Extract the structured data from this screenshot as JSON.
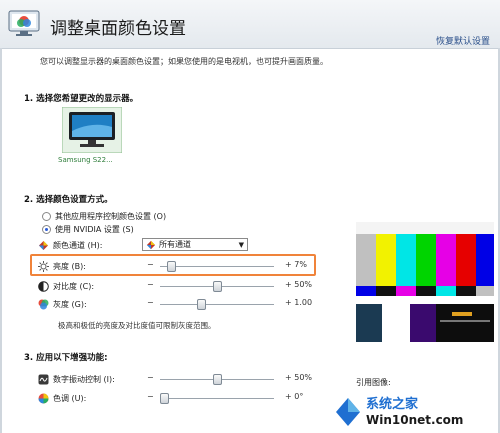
{
  "header": {
    "title": "调整桌面颜色设置",
    "restore_label": "恢复默认设置"
  },
  "description": "您可以调整显示器的桌面颜色设置；如果您使用的是电视机，也可提升画面质量。",
  "section1": {
    "heading": "1. 选择您希望更改的显示器。",
    "display_label": "Samsung S22..."
  },
  "section2": {
    "heading": "2. 选择颜色设置方式。",
    "radio_other": "其他应用程序控制颜色设置 (O)",
    "radio_nvidia": "使用 NVIDIA 设置 (S)",
    "channel_label": "颜色通道 (H):",
    "channel_value": "所有通道",
    "brightness": {
      "label": "亮度 (B):",
      "value": "+ 7%",
      "level": 0.07
    },
    "contrast": {
      "label": "对比度 (C):",
      "value": "+ 50%",
      "level": 0.5
    },
    "gamma": {
      "label": "灰度 (G):",
      "value": "+ 1.00",
      "level": 0.35
    },
    "note": "极高和极低的亮度及对比度值可限制灰度范围。"
  },
  "section3": {
    "heading": "3. 应用以下增强功能:",
    "vibrance": {
      "label": "数字振动控制 (I):",
      "value": "+ 50%",
      "level": 0.5
    },
    "hue": {
      "label": "色调 (U):",
      "value": "+ 0°",
      "level": 0.0
    },
    "ref_label": "引用图像:"
  },
  "minus": "−",
  "watermark": {
    "text": "Win10net.com",
    "brand": "系统之家"
  },
  "colors": {
    "highlight": "#f0833a",
    "accent": "#2a5bd7"
  }
}
